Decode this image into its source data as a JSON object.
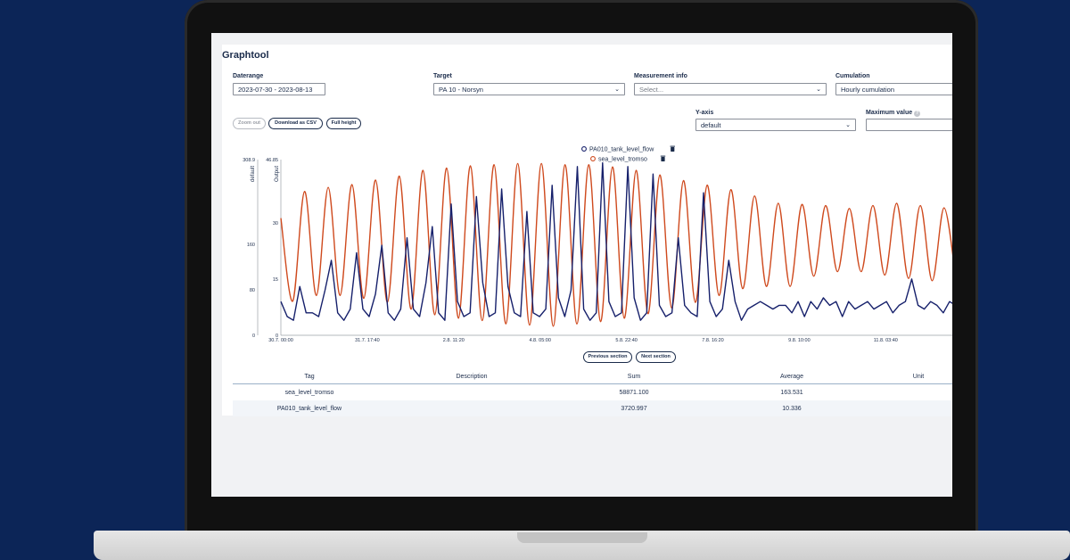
{
  "app": {
    "title": "Graphtool"
  },
  "filters": {
    "daterange": {
      "label": "Daterange",
      "value": "2023-07-30 - 2023-08-13"
    },
    "target": {
      "label": "Target",
      "value": "PA 10 - Norsyn"
    },
    "measurement": {
      "label": "Measurement info",
      "placeholder": "Select..."
    },
    "cumulation": {
      "label": "Cumulation",
      "value": "Hourly cumulation"
    }
  },
  "toolbar": {
    "zoom_out": "Zoom out",
    "download_csv": "Download as CSV",
    "full_height": "Full height"
  },
  "yaxis_control": {
    "label": "Y-axis",
    "value": "default"
  },
  "max_value": {
    "label": "Maximum value",
    "help": "?"
  },
  "navigation": {
    "previous": "Previous section",
    "next": "Next section"
  },
  "chart_data": {
    "type": "line",
    "x_tick_labels": [
      "30.7. 00:00",
      "31.7. 17:40",
      "2.8. 11:20",
      "4.8. 05:00",
      "5.8. 22:40",
      "7.8. 16:20",
      "9.8. 10:00",
      "11.8. 03:40"
    ],
    "y_axes": [
      {
        "label": "default",
        "ticks": [
          "308.9",
          "160",
          "80",
          "0"
        ],
        "range": [
          0,
          308.9
        ]
      },
      {
        "label": "Output",
        "ticks": [
          "46.85",
          "30",
          "15",
          "0"
        ],
        "range": [
          0,
          46.85
        ]
      }
    ],
    "legend_position": "top-center",
    "series": [
      {
        "name": "PA010_tank_level_flow",
        "axis": "Output",
        "color": "#16206b",
        "values": [
          9,
          5,
          4,
          13,
          6,
          6,
          5,
          12,
          20,
          6,
          4,
          7,
          22,
          7,
          5,
          11,
          24,
          6,
          4,
          7,
          26,
          7,
          5,
          14,
          29,
          6,
          4,
          35,
          9,
          5,
          6,
          37,
          14,
          5,
          6,
          39,
          13,
          6,
          5,
          33,
          6,
          5,
          7,
          40,
          10,
          5,
          12,
          45,
          7,
          4,
          6,
          46,
          9,
          5,
          6,
          45,
          10,
          4,
          6,
          43,
          8,
          5,
          6,
          26,
          8,
          6,
          5,
          38,
          9,
          5,
          7,
          20,
          9,
          4,
          7,
          8,
          9,
          8,
          7,
          8,
          8,
          6,
          9,
          5,
          9,
          7,
          10,
          8,
          9,
          5,
          9,
          7,
          8,
          9,
          7,
          8,
          9,
          6,
          8,
          9,
          15,
          8,
          7,
          9,
          8,
          6,
          9,
          8
        ]
      },
      {
        "name": "sea_level_tromso",
        "axis": "default",
        "color": "#cf4a1e",
        "values": [
          206,
          60,
          253,
          70,
          260,
          70,
          265,
          65,
          273,
          58,
          280,
          46,
          290,
          36,
          294,
          30,
          298,
          26,
          300,
          20,
          302,
          18,
          302,
          16,
          300,
          20,
          300,
          24,
          296,
          30,
          290,
          38,
          282,
          48,
          272,
          58,
          264,
          70,
          256,
          82,
          245,
          86,
          232,
          86,
          230,
          104,
          228,
          112,
          223,
          112,
          228,
          106,
          232,
          100,
          228,
          96,
          224,
          100
        ]
      }
    ]
  },
  "table": {
    "headers": [
      "Tag",
      "Description",
      "Sum",
      "Average",
      "Unit"
    ],
    "rows": [
      [
        "sea_level_tromso",
        "",
        "58871.100",
        "163.531",
        ""
      ],
      [
        "PA010_tank_level_flow",
        "",
        "3720.997",
        "10.336",
        ""
      ]
    ]
  }
}
